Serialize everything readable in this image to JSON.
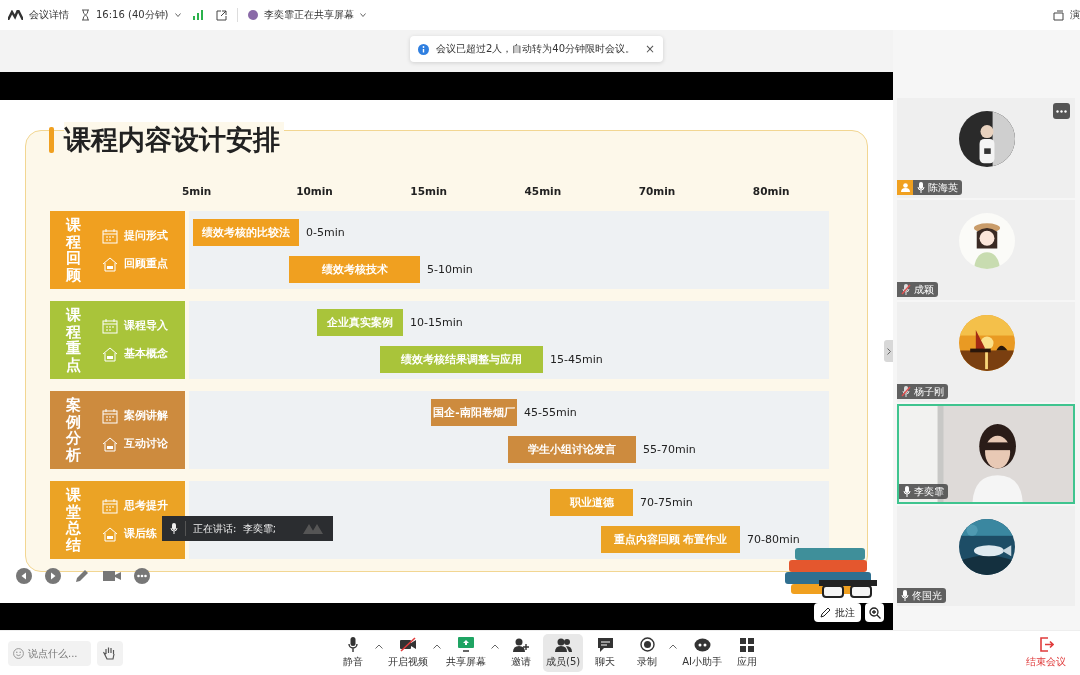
{
  "top_bar": {
    "app_label": "会议详情",
    "time": "16:16 (40分钟)",
    "sharing_label": "李奕霏正在共享屏幕",
    "right_label": "演"
  },
  "notice": {
    "text": "会议已超过2人，自动转为40分钟限时会议。",
    "close": "×"
  },
  "slide": {
    "title": "课程内容设计安排",
    "axis": [
      "5min",
      "10min",
      "15min",
      "45min",
      "70min",
      "80min"
    ],
    "groups": [
      {
        "label": "课程回顾",
        "color": "#f0a020",
        "items": [
          "提问形式",
          "回顾重点"
        ],
        "bars": [
          {
            "text": "绩效考核的比较法",
            "range": "0-5min"
          },
          {
            "text": "绩效考核技术",
            "range": "5-10min"
          }
        ]
      },
      {
        "label": "课程重点",
        "color": "#a9c43a",
        "items": [
          "课程导入",
          "基本概念"
        ],
        "bars": [
          {
            "text": "企业真实案例",
            "range": "10-15min"
          },
          {
            "text": "绩效考核结果调整与应用",
            "range": "15-45min"
          }
        ]
      },
      {
        "label": "案例分析",
        "color": "#cd8b3e",
        "items": [
          "案例讲解",
          "互动讨论"
        ],
        "bars": [
          {
            "text": "国企-南阳卷烟厂",
            "range": "45-55min"
          },
          {
            "text": "学生小组讨论发言",
            "range": "55-70min"
          }
        ]
      },
      {
        "label": "课堂总结",
        "color": "#eba325",
        "items": [
          "思考提升",
          "课后练"
        ],
        "bars": [
          {
            "text": "职业道德",
            "range": "70-75min"
          },
          {
            "text": "重点内容回顾 布置作业",
            "range": "70-80min"
          }
        ]
      }
    ]
  },
  "speaking_popup": {
    "text": "正在讲话:  李奕霏;"
  },
  "annotate_button": "批注",
  "participants": [
    {
      "name": "陈海英",
      "kind": "avatar",
      "host": true,
      "muted": false,
      "speaking": false
    },
    {
      "name": "成颖",
      "kind": "avatar",
      "host": false,
      "muted": true,
      "speaking": false
    },
    {
      "name": "杨子刚",
      "kind": "avatar",
      "host": false,
      "muted": true,
      "speaking": false
    },
    {
      "name": "李奕霏",
      "kind": "video",
      "host": false,
      "muted": false,
      "speaking": true
    },
    {
      "name": "佟国光",
      "kind": "avatar",
      "host": false,
      "muted": false,
      "speaking": false
    }
  ],
  "toolbar": {
    "chat_placeholder": "说点什么...",
    "buttons": [
      {
        "label": "静音",
        "menu": true,
        "selected": false
      },
      {
        "label": "开启视频",
        "menu": true,
        "selected": false
      },
      {
        "label": "共享屏幕",
        "menu": true,
        "selected": false
      },
      {
        "label": "邀请",
        "menu": false,
        "selected": false
      },
      {
        "label": "成员(5)",
        "menu": false,
        "selected": true
      },
      {
        "label": "聊天",
        "menu": false,
        "selected": false
      },
      {
        "label": "录制",
        "menu": true,
        "selected": false
      },
      {
        "label": "AI小助手",
        "menu": false,
        "selected": false
      },
      {
        "label": "应用",
        "menu": false,
        "selected": false
      }
    ],
    "end_button": "结束会议"
  }
}
